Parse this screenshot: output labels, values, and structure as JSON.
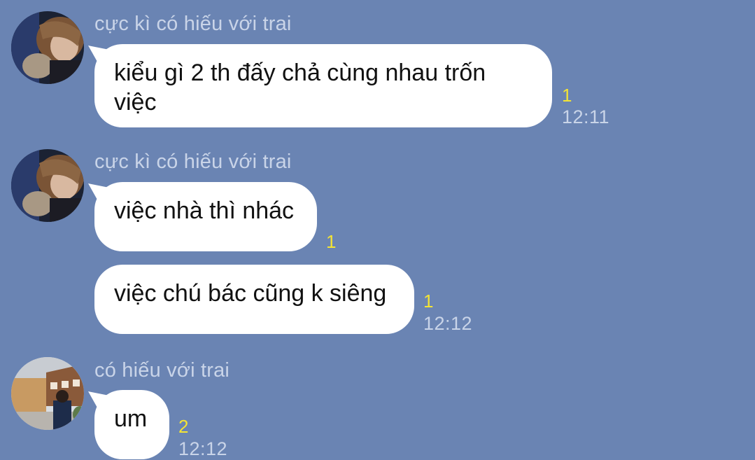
{
  "messages": [
    {
      "sender": "cực kì có hiếu với trai",
      "text": "kiểu gì 2 th đấy chả cùng nhau trốn việc",
      "read": "1",
      "time": "12:11"
    },
    {
      "sender": "cực kì có hiếu với trai",
      "text": "việc nhà thì nhác",
      "read": "1",
      "time": ""
    },
    {
      "sender": "",
      "text": "việc chú bác cũng k siêng",
      "read": "1",
      "time": "12:12"
    },
    {
      "sender": "có hiếu với trai",
      "text": "um",
      "read": "2",
      "time": "12:12"
    }
  ],
  "avatars": {
    "user1": "photo-avatar",
    "user2": "photo-avatar"
  },
  "colors": {
    "background": "#6a84b3",
    "bubble": "#ffffff",
    "read_count": "#f4e434",
    "meta_text": "#c9d4e8"
  }
}
